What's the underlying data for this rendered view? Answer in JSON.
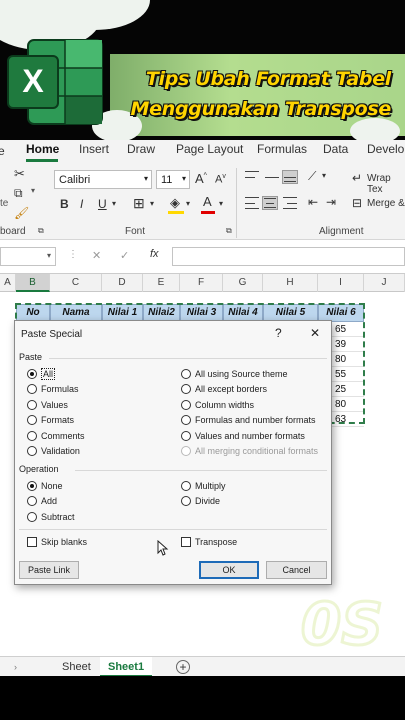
{
  "banner": {
    "title_line1": "Tips Ubah Format Tabel",
    "title_line2": "Menggunakan Transpose",
    "logo_letter": "X",
    "logo_icon": "excel-logo-icon",
    "colors": {
      "title": "#ffd400",
      "band": "#a9d58a",
      "logo_green": "#1f7a3e"
    }
  },
  "ribbon": {
    "tabs": [
      "Home",
      "Insert",
      "Draw",
      "Page Layout",
      "Formulas",
      "Data",
      "Develop"
    ],
    "active_tab": "Home",
    "clipboard_label": "board",
    "font_name": "Calibri",
    "font_size": "11",
    "grow_font": "A",
    "shrink_font": "A",
    "bold": "B",
    "italic": "I",
    "underline": "U",
    "font_group_label": "Font",
    "wrap_text": "Wrap Tex",
    "merge": "Merge &",
    "alignment_group_label": "Alignment",
    "accent": "#1a7a3f"
  },
  "formula_bar": {
    "fx": "fx",
    "cancel": "✕",
    "confirm": "✓"
  },
  "grid": {
    "columns": [
      "A",
      "B",
      "C",
      "D",
      "E",
      "F",
      "G",
      "H",
      "I",
      "J"
    ],
    "selected_column": "B",
    "headers": [
      "No",
      "Nama",
      "Nilai 1",
      "Nilai2",
      "Nilai 3",
      "Nilai 4",
      "Nilai 5",
      "Nilai 6"
    ],
    "visible_values_col_nilai6": [
      "65",
      "39",
      "80",
      "55",
      "25",
      "80",
      "63"
    ]
  },
  "dialog": {
    "title": "Paste Special",
    "help": "?",
    "close": "✕",
    "paste_section": "Paste",
    "paste_left": [
      "All",
      "Formulas",
      "Values",
      "Formats",
      "Comments",
      "Validation"
    ],
    "paste_right": [
      "All using Source theme",
      "All except borders",
      "Column widths",
      "Formulas and number formats",
      "Values and number formats",
      "All merging conditional formats"
    ],
    "selected_paste": "All",
    "operation_section": "Operation",
    "operation_left": [
      "None",
      "Add",
      "Subtract"
    ],
    "operation_right": [
      "Multiply",
      "Divide"
    ],
    "selected_operation": "None",
    "skip_blanks": "Skip blanks",
    "transpose": "Transpose",
    "paste_link": "Paste Link",
    "ok": "OK",
    "cancel": "Cancel"
  },
  "sheet_tabs": {
    "tabs": [
      "Sheet",
      "Sheet1"
    ],
    "active": "Sheet1",
    "add": "+"
  },
  "watermark": "0S"
}
